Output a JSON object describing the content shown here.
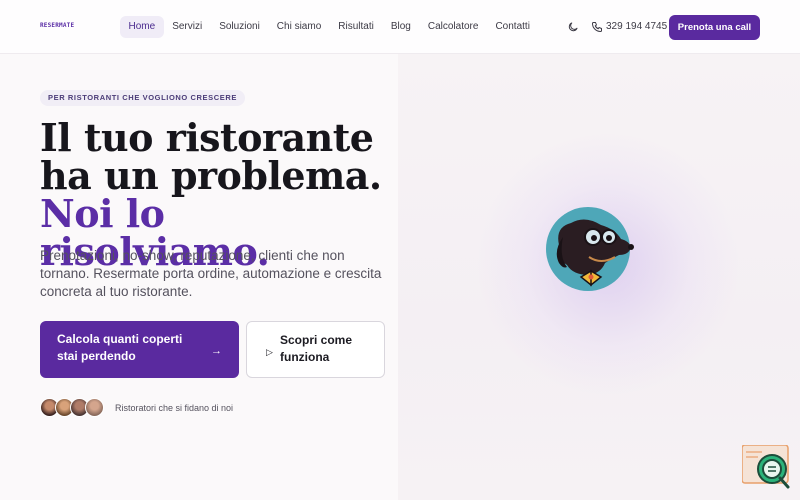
{
  "header": {
    "logo_text": "RESERMATE",
    "nav": [
      "Home",
      "Servizi",
      "Soluzioni",
      "Chi siamo",
      "Risultati",
      "Blog",
      "Calcolatore",
      "Contatti"
    ],
    "phone": "329 194 4745",
    "cta_label": "Prenota una call"
  },
  "hero": {
    "eyebrow": "PER RISTORANTI CHE VOGLIONO CRESCERE",
    "headline_part1": "Il tuo ristorante ha un problema.",
    "headline_accent": "Noi lo risolviamo.",
    "subtext": "Prenotazioni, no-show, reputazione, clienti che non tornano. Resermate porta ordine, automazione e crescita concreta al tuo ristorante.",
    "primary_button": "Calcola quanti coperti stai perdendo",
    "secondary_button": "Scopri come funziona",
    "trust_text": "Ristoratori che si fidano di noi"
  },
  "colors": {
    "accent": "#5a2a9f",
    "background": "#fbf9fa",
    "headline": "#17161c"
  },
  "icons": [
    "moon-icon",
    "phone-icon",
    "arrow-right-icon",
    "play-icon",
    "mascot-dog-icon",
    "chat-widget-icon"
  ]
}
